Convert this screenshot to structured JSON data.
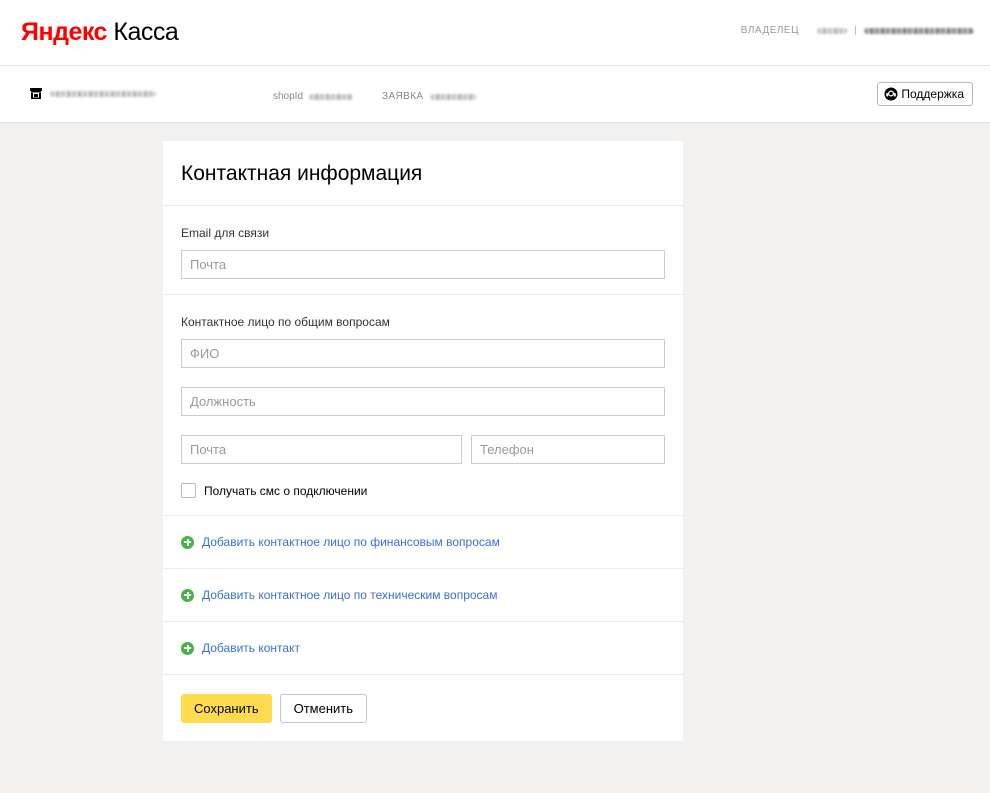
{
  "header": {
    "logo_ya": "Яндекс",
    "logo_kassa": "Касса",
    "owner_label": "ВЛАДЕЛЕЦ"
  },
  "subheader": {
    "shop_id_label": "shopId",
    "application_label": "ЗАЯВКА",
    "support_label": "Поддержка"
  },
  "form": {
    "title": "Контактная информация",
    "email_section": {
      "label": "Email для связи",
      "email_placeholder": "Почта",
      "email_value": ""
    },
    "contact_section": {
      "label": "Контактное лицо по общим вопросам",
      "name_placeholder": "ФИО",
      "position_placeholder": "Должность",
      "email_placeholder": "Почта",
      "phone_placeholder": "Телефон",
      "sms_checkbox_label": "Получать смс о подключении",
      "sms_checked": false
    },
    "add_links": [
      "Добавить контактное лицо по финансовым вопросам",
      "Добавить контактное лицо по техническим вопросам",
      "Добавить контакт"
    ],
    "save_label": "Сохранить",
    "cancel_label": "Отменить"
  },
  "colors": {
    "logo_red": "#ff0000",
    "link_blue": "#3a6fd4",
    "plus_green": "#47b347",
    "save_yellow": "#ffdb4d",
    "page_bg": "#f2f1ef"
  },
  "icons": {
    "shop": "shop-icon",
    "support": "headset-icon",
    "add": "plus-circle-icon"
  }
}
